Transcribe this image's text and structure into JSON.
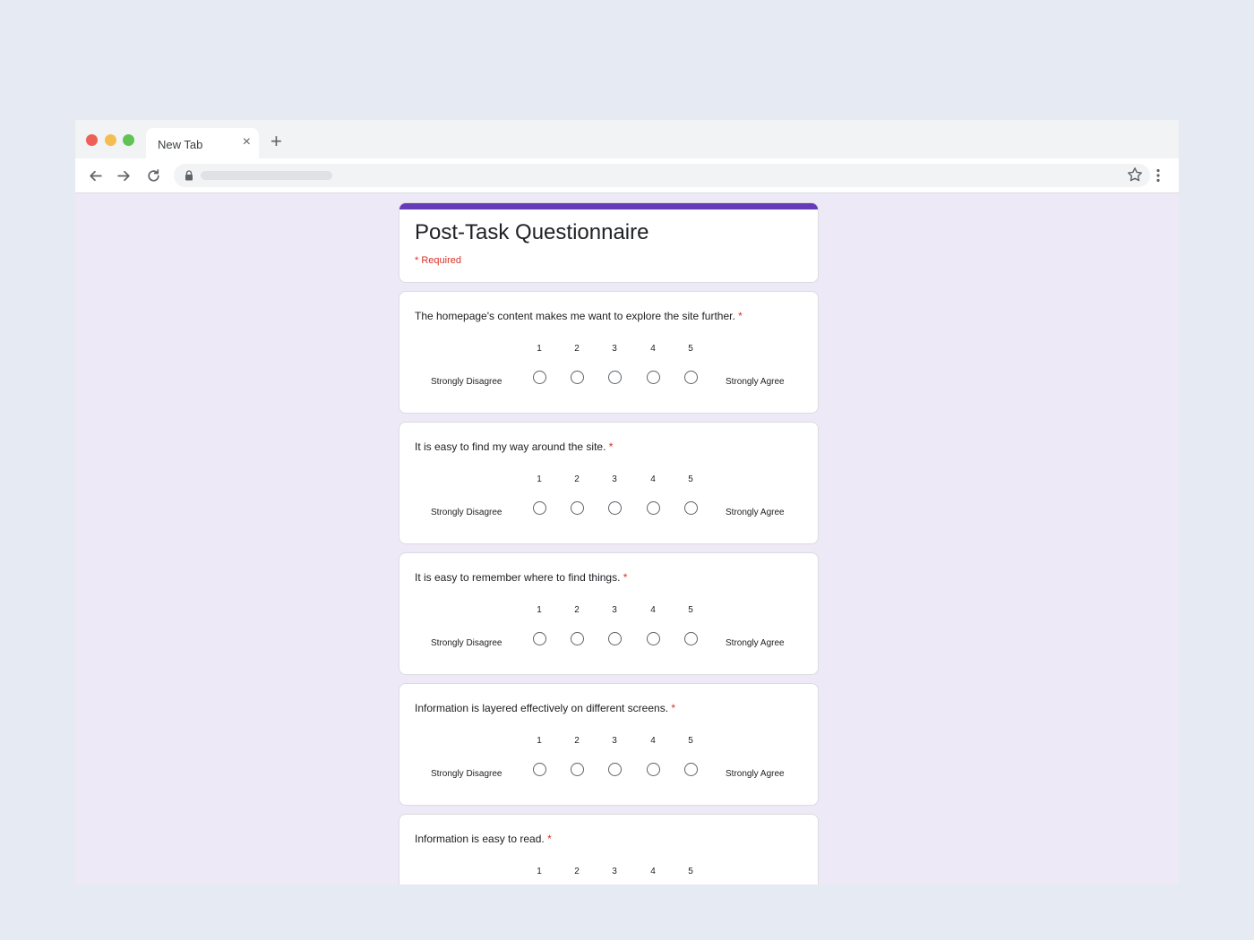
{
  "browser": {
    "tab_title": "New Tab",
    "close_glyph": "×",
    "new_tab_glyph": "+"
  },
  "form": {
    "title": "Post-Task Questionnaire",
    "required_note": "* Required",
    "scale": [
      "1",
      "2",
      "3",
      "4",
      "5"
    ],
    "low_label": "Strongly Disagree",
    "high_label": "Strongly Agree",
    "required_star": "*",
    "questions": [
      {
        "text": "The homepage's content makes me want to explore the site further."
      },
      {
        "text": "It is easy to find my way around the site."
      },
      {
        "text": "It is easy to remember where to find things."
      },
      {
        "text": "Information is layered effectively on different screens."
      },
      {
        "text": "Information is easy to read."
      }
    ]
  },
  "colors": {
    "accent": "#673ab7",
    "required": "#d93025",
    "page_bg": "#ede9f6"
  }
}
